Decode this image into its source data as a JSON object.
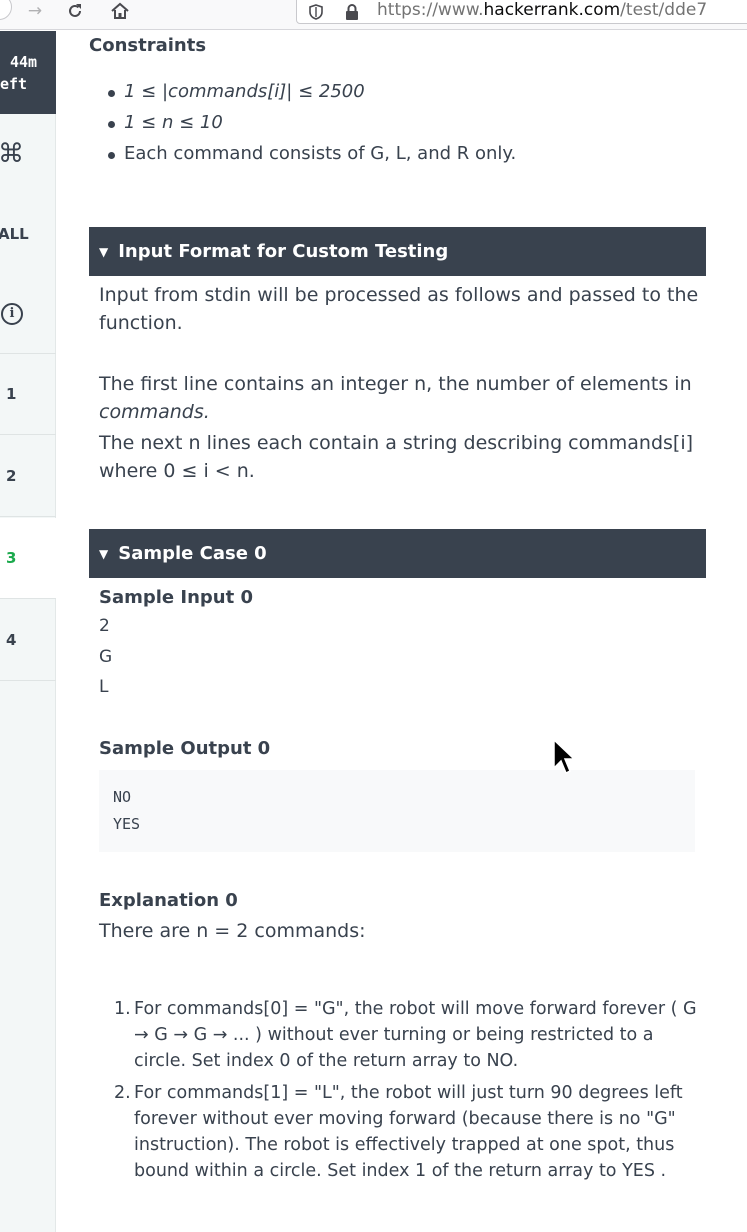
{
  "browser": {
    "url_prefix": "https://www.",
    "url_domain": "hackerrank.com",
    "url_path": "/test/dde7"
  },
  "sidebar": {
    "timer_line1": "44m",
    "timer_line2": "eft",
    "all_label": "ALL",
    "questions": [
      "1",
      "2",
      "3",
      "4"
    ],
    "active_question": "3"
  },
  "constraints": {
    "heading": "Constraints",
    "items": [
      "1 ≤ |commands[i]| ≤ 2500",
      "1 ≤ n ≤ 10",
      "Each command consists of G, L, and R only."
    ]
  },
  "input_format": {
    "title": "Input Format for Custom Testing",
    "line1": "Input from stdin will be processed as follows and passed to the",
    "line2": "function.",
    "line3": "The first line contains an integer n, the number of elements in",
    "line4": "commands.",
    "line5": "The next n lines each contain a string describing commands[i]",
    "line6": "where 0 ≤ i < n."
  },
  "sample_case": {
    "title": "Sample Case 0",
    "input_heading": "Sample Input 0",
    "input_lines": [
      "2",
      "G",
      "L"
    ],
    "output_heading": "Sample Output 0",
    "output_lines": [
      "NO",
      "YES"
    ],
    "explanation_heading": "Explanation 0",
    "explanation_intro": "There are n = 2 commands:",
    "explanation_items": [
      {
        "number": "1.",
        "lines": [
          "For commands[0] = \"G\", the robot will move forward forever ( G",
          "→ G → G → ... ) without ever turning or being restricted to a",
          "circle. Set index 0 of the return array to NO."
        ]
      },
      {
        "number": "2.",
        "lines": [
          "For commands[1] = \"L\", the robot will just turn 90 degrees left",
          "forever without ever moving forward (because there is no \"G\"",
          "instruction). The robot is effectively trapped at one spot, thus",
          "bound within a circle. Set index 1 of the return array to YES ."
        ]
      }
    ]
  }
}
